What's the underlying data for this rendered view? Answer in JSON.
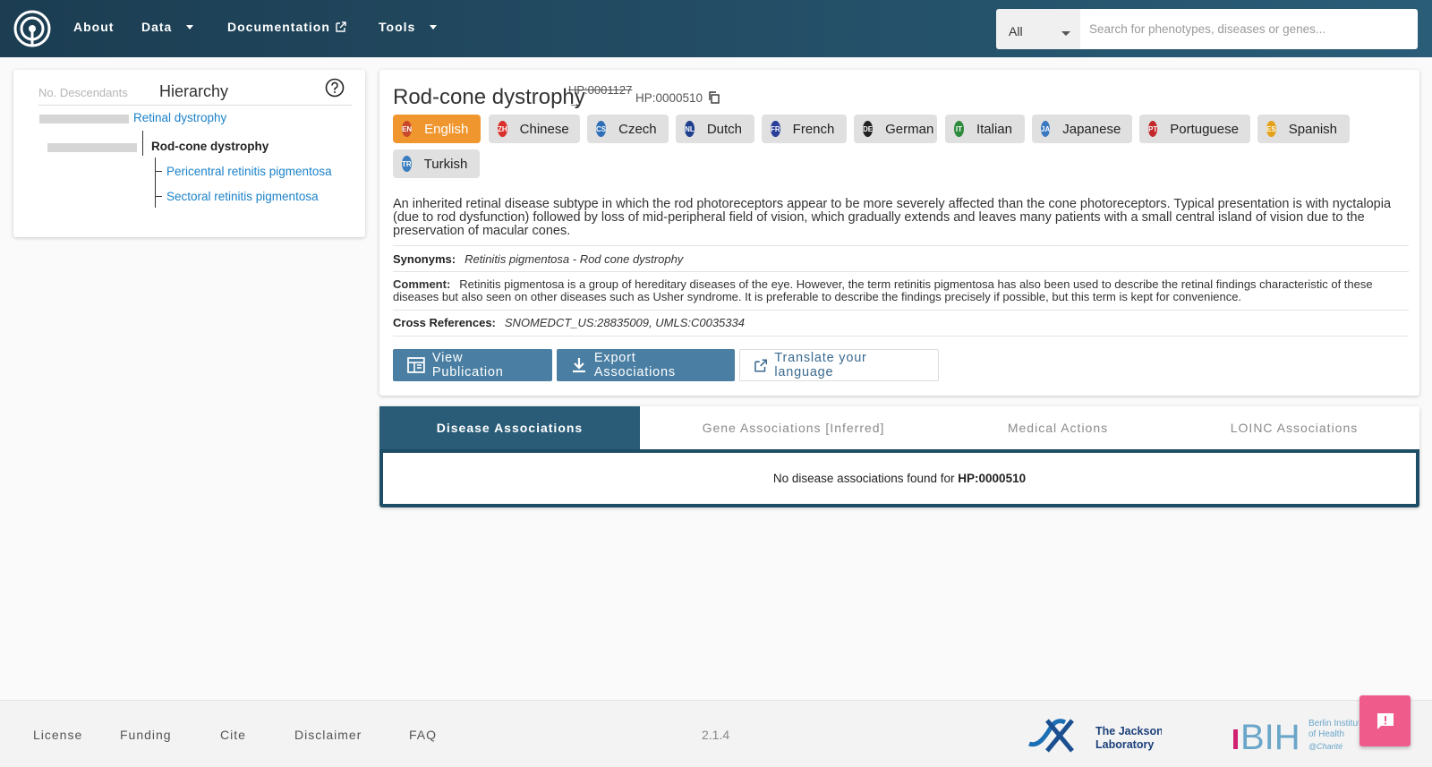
{
  "nav": {
    "about": "About",
    "data": "Data",
    "documentation": "Documentation",
    "tools": "Tools",
    "search_scope": "All",
    "search_placeholder": "Search for phenotypes, diseases or genes..."
  },
  "hierarchy": {
    "descendants_label": "No. Descendants",
    "title": "Hierarchy",
    "parent": "Retinal dystrophy",
    "current": "Rod-cone dystrophy",
    "children": [
      "Pericentral retinitis pigmentosa",
      "Sectoral retinitis pigmentosa"
    ]
  },
  "term": {
    "name": "Rod-cone dystrophy",
    "obsolete_id": "HP:0001127",
    "arrow": "→",
    "id": "HP:0000510",
    "languages": [
      {
        "code": "EN",
        "name": "English",
        "color": "#c84a2a"
      },
      {
        "code": "ZH",
        "name": "Chinese",
        "color": "#d9302c"
      },
      {
        "code": "CS",
        "name": "Czech",
        "color": "#2e6fb5"
      },
      {
        "code": "NL",
        "name": "Dutch",
        "color": "#1f3f8f"
      },
      {
        "code": "FR",
        "name": "French",
        "color": "#2a3f9a"
      },
      {
        "code": "DE",
        "name": "German",
        "color": "#222222"
      },
      {
        "code": "IT",
        "name": "Italian",
        "color": "#2e8b3d"
      },
      {
        "code": "JA",
        "name": "Japanese",
        "color": "#3a78c0"
      },
      {
        "code": "PT",
        "name": "Portuguese",
        "color": "#c3282b"
      },
      {
        "code": "ES",
        "name": "Spanish",
        "color": "#e3a21a"
      },
      {
        "code": "TR",
        "name": "Turkish",
        "color": "#3b7fc0"
      }
    ],
    "description": "An inherited retinal disease subtype in which the rod photoreceptors appear to be more severely affected than the cone photoreceptors. Typical presentation is with nyctalopia (due to rod dysfunction) followed by loss of mid-peripheral field of vision, which gradually extends and leaves many patients with a small central island of vision due to the preservation of macular cones.",
    "synonyms_label": "Synonyms:",
    "synonyms": "Retinitis pigmentosa - Rod cone dystrophy",
    "comment_label": "Comment:",
    "comment": "Retinitis pigmentosa is a group of hereditary diseases of the eye. However, the term retinitis pigmentosa has also been used to describe the retinal findings characteristic of these diseases but also seen on other diseases such as Usher syndrome. It is preferable to describe the findings precisely if possible, but this term is kept for convenience.",
    "xref_label": "Cross References:",
    "xrefs": "SNOMEDCT_US:28835009, UMLS:C0035334",
    "buttons": {
      "view_publication": "View Publication",
      "export": "Export Associations",
      "translate": "Translate your language"
    }
  },
  "tabs": {
    "items": [
      "Disease Associations",
      "Gene Associations [Inferred]",
      "Medical Actions",
      "LOINC Associations"
    ],
    "empty_prefix": "No disease associations found for",
    "empty_id": "HP:0000510"
  },
  "footer": {
    "links": [
      "License",
      "Funding",
      "Cite",
      "Disclaimer",
      "FAQ"
    ],
    "version": "2.1.4",
    "jax_line1": "The Jackson",
    "jax_line2": "Laboratory",
    "bih_text": "BIH",
    "bih_line1": "Berlin Institute",
    "bih_line2": "of Health",
    "bih_line3": "@Charité"
  }
}
